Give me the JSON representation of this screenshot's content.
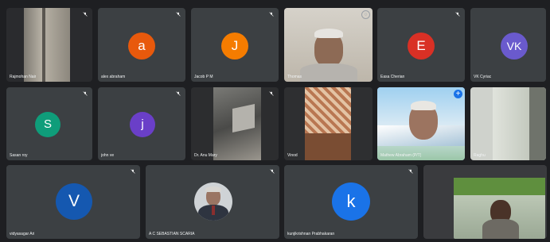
{
  "participants": [
    {
      "name": "Rajmohan Nair",
      "initial": "",
      "color": ""
    },
    {
      "name": "alex abraham",
      "initial": "a",
      "color": "#e8590c"
    },
    {
      "name": "Jacob P M",
      "initial": "J",
      "color": "#f57c00"
    },
    {
      "name": "Thomas",
      "initial": "",
      "color": ""
    },
    {
      "name": "Easa Cherian",
      "initial": "E",
      "color": "#d93025"
    },
    {
      "name": "VK Cyriac",
      "initial": "VK",
      "color": "#6a5acd"
    },
    {
      "name": "Sasan roy",
      "initial": "S",
      "color": "#0f9d7a"
    },
    {
      "name": "john ve",
      "initial": "j",
      "color": "#6a3fc8"
    },
    {
      "name": "Dr. Anu Mary",
      "initial": "",
      "color": ""
    },
    {
      "name": "Vinod",
      "initial": "",
      "color": ""
    },
    {
      "name": "Mathew Abraham (P/T)",
      "initial": "",
      "color": ""
    },
    {
      "name": "Raghu",
      "initial": "",
      "color": ""
    },
    {
      "name": "vidyasagar Ari",
      "initial": "V",
      "color": "#1558b0"
    },
    {
      "name": "A C SEBASTIAN SCARIA",
      "initial": "",
      "color": ""
    },
    {
      "name": "kunjikrishnan Prabhakaran",
      "initial": "k",
      "color": "#1a73e8"
    },
    {
      "name": "",
      "initial": "",
      "color": ""
    }
  ]
}
